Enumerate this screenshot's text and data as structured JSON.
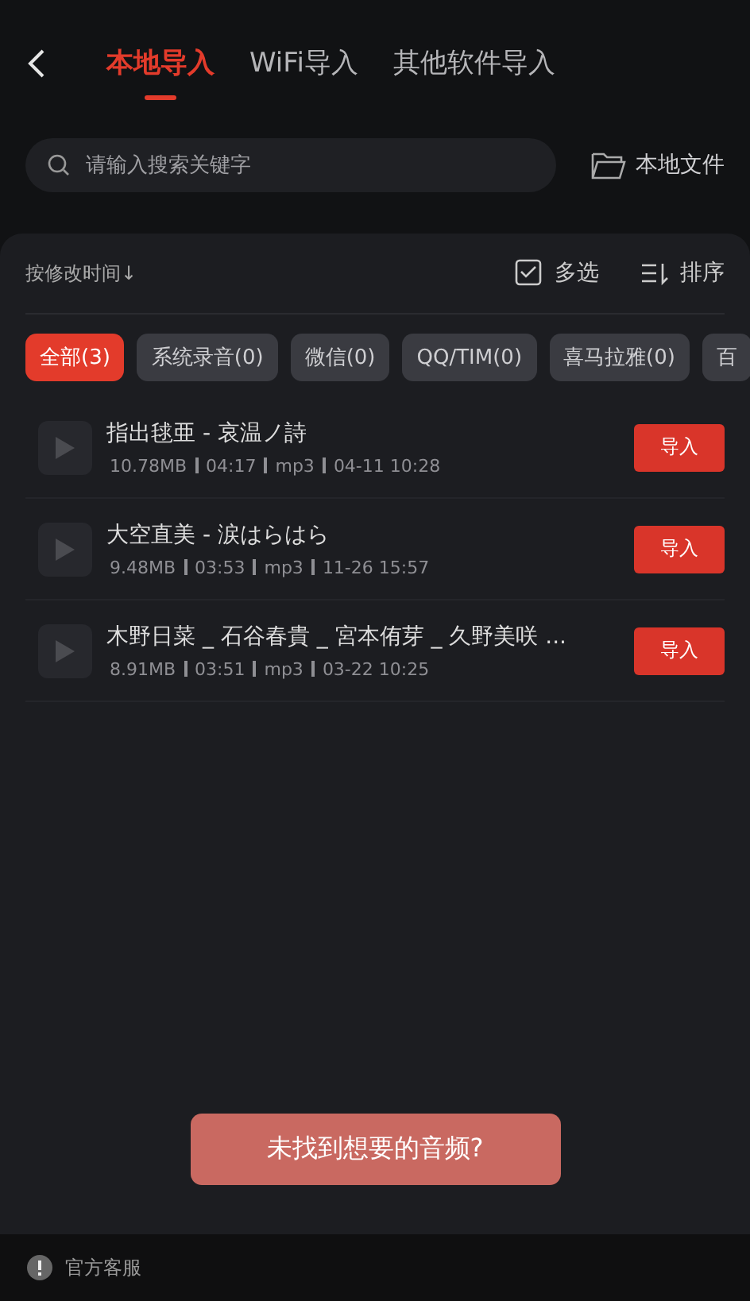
{
  "tabs": [
    {
      "label": "本地导入",
      "selected": true
    },
    {
      "label": "WiFi导入",
      "selected": false
    },
    {
      "label": "其他软件导入",
      "selected": false
    }
  ],
  "search": {
    "placeholder": "请输入搜索关键字"
  },
  "local_files": "本地文件",
  "toolbar": {
    "sort_label": "按修改时间↓",
    "multi_select": "多选",
    "sort": "排序"
  },
  "chips": [
    {
      "label": "全部(3)",
      "selected": true
    },
    {
      "label": "系统录音(0)",
      "selected": false
    },
    {
      "label": "微信(0)",
      "selected": false
    },
    {
      "label": "QQ/TIM(0)",
      "selected": false
    },
    {
      "label": "喜马拉雅(0)",
      "selected": false
    },
    {
      "label": "百",
      "selected": false
    }
  ],
  "files": [
    {
      "title": "指出毬亜 - 哀温ノ詩",
      "size": "10.78MB",
      "duration": "04:17",
      "format": "mp3",
      "date": "04-11 10:28",
      "action": "导入"
    },
    {
      "title": "大空直美 - 涙はらはら",
      "size": "9.48MB",
      "duration": "03:53",
      "format": "mp3",
      "date": "11-26 15:57",
      "action": "导入"
    },
    {
      "title": "木野日菜 _ 石谷春貴 _ 宮本侑芽 _ 久野美咲 ...",
      "size": "8.91MB",
      "duration": "03:51",
      "format": "mp3",
      "date": "03-22 10:25",
      "action": "导入"
    }
  ],
  "not_found_button": "未找到想要的音频?",
  "footer": {
    "label": "官方客服"
  }
}
